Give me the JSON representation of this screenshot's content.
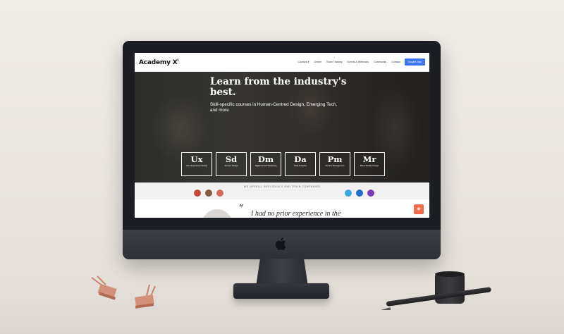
{
  "scene": {
    "background_color": "#ece8e3",
    "device": "iMac"
  },
  "website": {
    "logo_text": "Academy X",
    "logo_sup": "i",
    "nav_links": [
      "Courses",
      "Online",
      "Team Training",
      "Events & Webinars",
      "Community",
      "Contact"
    ],
    "nav_courses_chevron": "▾",
    "nav_cta": "Enquire Now",
    "hero": {
      "title": "Learn from the industry's best.",
      "subtitle": "Skill-specific courses in Human-Centred Design, Emerging Tech, and more"
    },
    "courses": [
      {
        "code": "Ux",
        "name": "User Experience Design"
      },
      {
        "code": "Sd",
        "name": "Service Design"
      },
      {
        "code": "Dm",
        "name": "Digital Growth Marketing"
      },
      {
        "code": "Da",
        "name": "Data Analytics"
      },
      {
        "code": "Pm",
        "name": "Product Management"
      },
      {
        "code": "Mr",
        "name": "Mixed Reality Design"
      }
    ],
    "clients_heading": "WE UPSKILL INDIVIDUALS AND TRAIN COMPANIES",
    "testimonial": {
      "quote_mark": "“",
      "quote_start": "I had no prior experience in the"
    },
    "colors": {
      "cta_blue": "#3d78f0",
      "chat_orange": "#f26a4b",
      "hero_dark": "#3a3935"
    }
  }
}
